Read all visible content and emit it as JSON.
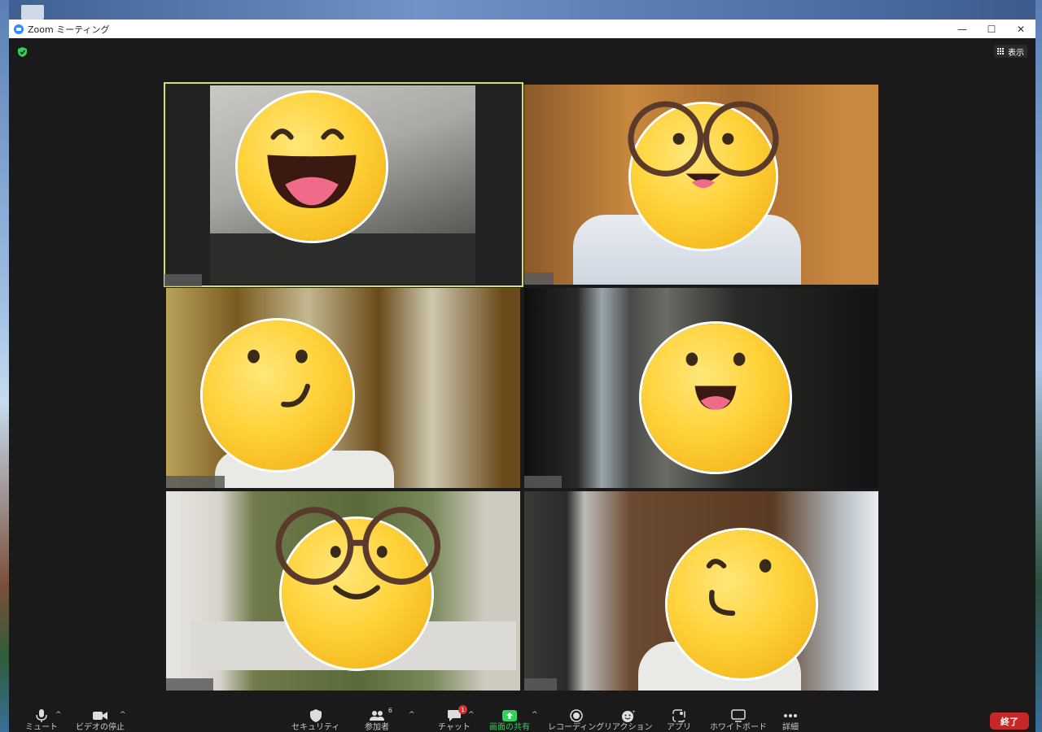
{
  "window": {
    "title": "Zoom ミーティング",
    "minimize": "—",
    "maximize": "☐",
    "close": "✕"
  },
  "topbar": {
    "view_label": "表示"
  },
  "toolbar": {
    "mute": "ミュート",
    "video": "ビデオの停止",
    "security": "セキュリティ",
    "participants": "参加者",
    "participants_count": "6",
    "chat": "チャット",
    "chat_badge": "1",
    "share": "画面の共有",
    "record": "レコーディング",
    "reactions": "リアクション",
    "apps": "アプリ",
    "whiteboard": "ホワイトボード",
    "more": "詳細",
    "end": "終了"
  },
  "colors": {
    "active_speaker": "#d6df6c",
    "share_green": "#2ed058",
    "end_red": "#c62828",
    "emoji_yellow": "#ffd23a"
  },
  "tiles": [
    {
      "emoji": "laughing-face",
      "active": true
    },
    {
      "emoji": "smiling-face-with-glasses",
      "active": false
    },
    {
      "emoji": "smirking-face",
      "active": false
    },
    {
      "emoji": "happy-face",
      "active": false
    },
    {
      "emoji": "smiling-face-with-glasses",
      "active": false
    },
    {
      "emoji": "winking-face",
      "active": false
    }
  ]
}
